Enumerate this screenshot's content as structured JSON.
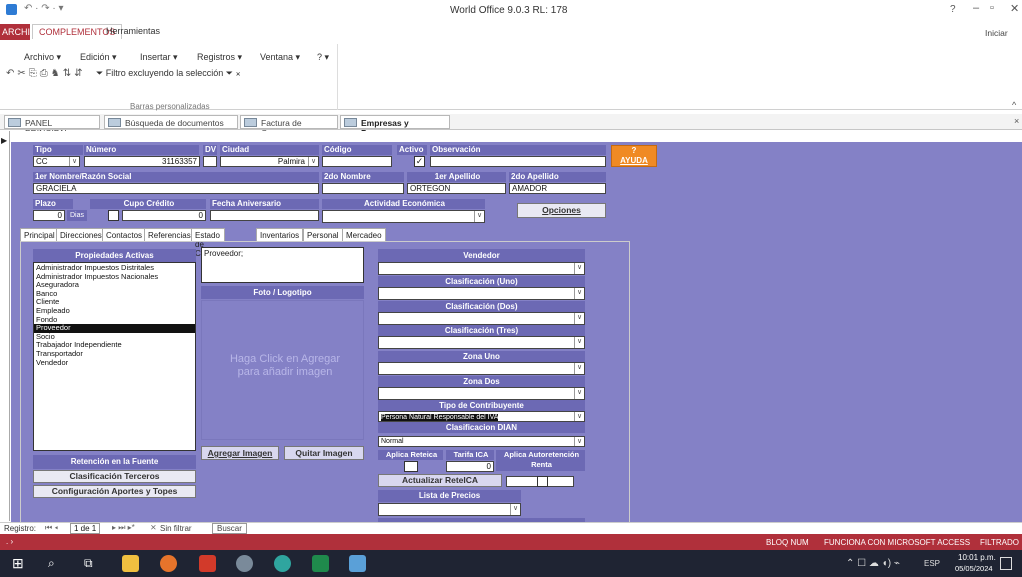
{
  "window": {
    "title": "World Office 9.0.3 RL: 178",
    "help": "?",
    "signin": "Iniciar sesi"
  },
  "ribbon_tabs": [
    "ARCHIVO",
    "COMPLEMENTOS",
    "Herramientas"
  ],
  "menus": [
    "Archivo",
    "Edición",
    "Insertar",
    "Registros",
    "Ventana",
    "?"
  ],
  "toolbar": {
    "filter_label": "Filtro excluyendo la selección",
    "group_label": "Barras personalizadas"
  },
  "doc_tabs": [
    "PANEL PRINCIPAL",
    "Búsqueda de documentos",
    "Factura de Compra",
    "Empresas y Personas"
  ],
  "header": {
    "tipo_label": "Tipo",
    "tipo_value": "CC",
    "numero_label": "Número",
    "numero_value": "31163357",
    "dv_label": "DV",
    "ciudad_label": "Ciudad",
    "ciudad_value": "Palmira",
    "codigo_label": "Código",
    "activo_label": "Activo",
    "observacion_label": "Observación",
    "ayuda_q": "?",
    "ayuda_label": "AYUDA",
    "nombre1_label": "1er Nombre/Razón Social",
    "nombre1_value": "GRACIELA",
    "nombre2_label": "2do Nombre",
    "apellido1_label": "1er Apellido",
    "apellido1_value": "ORTEGON",
    "apellido2_label": "2do Apellido",
    "apellido2_value": "AMADOR",
    "plazo_label": "Plazo",
    "plazo_value": "0",
    "dias_label": "Dias",
    "cupo_label": "Cupo Crédito",
    "cupo_value": "0",
    "aniversario_label": "Fecha Aniversario",
    "actividad_label": "Actividad Económica",
    "opciones_label": "Opciones"
  },
  "sub_tabs": [
    "Principal",
    "Direcciones",
    "Contactos",
    "Referencias",
    "Estado de Cuenta",
    "Inventarios",
    "Personal",
    "Mercadeo"
  ],
  "propiedades": {
    "title": "Propiedades Activas",
    "items": [
      "Administrador Impuestos Distritales",
      "Administrador Impuestos Nacionales",
      "Aseguradora",
      "Banco",
      "Cliente",
      "Empleado",
      "Fondo",
      "Proveedor",
      "Socio",
      "Trabajador Independiente",
      "Transportador",
      "Vendedor"
    ],
    "selected": "Proveedor"
  },
  "retencion": {
    "title": "Retención en la Fuente",
    "clasificacion_btn": "Clasificación Terceros",
    "config_btn": "Configuración Aportes y Topes"
  },
  "foto": {
    "obs_value": "Proveedor;",
    "title": "Foto / Logotipo",
    "placeholder": "Haga Click en Agregar para añadir imagen",
    "add_btn": "Agregar Imagen",
    "remove_btn": "Quitar Imagen"
  },
  "right_panel": {
    "vendedor": "Vendedor",
    "clas_uno": "Clasificación (Uno)",
    "clas_dos": "Clasificación (Dos)",
    "clas_tres": "Clasificación (Tres)",
    "zona_uno": "Zona Uno",
    "zona_dos": "Zona Dos",
    "tipo_contrib": "Tipo de Contribuyente",
    "tipo_contrib_value": "Persona Natural Responsable del IVA",
    "clas_dian": "Clasificacion DIAN",
    "clas_dian_value": "Normal",
    "aplica_reteica": "Aplica Reteica",
    "tarifa_ica": "Tarifa ICA",
    "tarifa_value": "0",
    "autoret_label": "Aplica Autoretención Renta",
    "actualizar_btn": "Actualizar ReteICA",
    "lista_precios": "Lista de Precios"
  },
  "nav": {
    "registro_label": "Registro:",
    "position": "1 de 1",
    "filter": "Sin filtrar",
    "search": "Buscar"
  },
  "app_status": {
    "bloq": "BLOQ NUM",
    "msg": "FUNCIONA CON MICROSOFT ACCESS",
    "filtrado": "FILTRADO"
  },
  "taskbar": {
    "lang": "ESP",
    "time": "10:01 p.m.",
    "date": "05/05/2024"
  },
  "colors": {
    "accent": "#b0303b",
    "form_bg": "#8481c6",
    "header_bg": "#6c69b4",
    "ayuda": "#f08a24"
  }
}
